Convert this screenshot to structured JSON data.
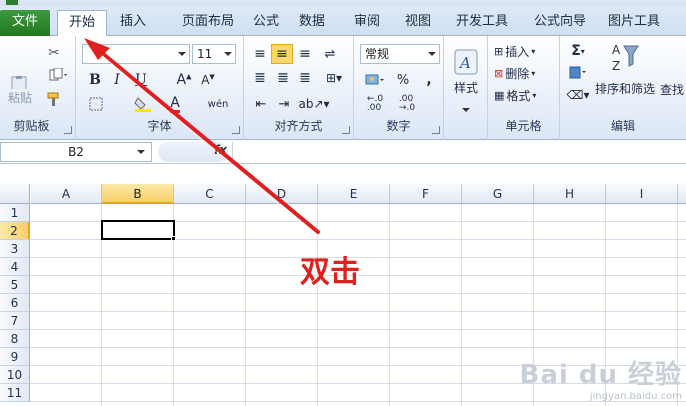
{
  "ribbon_tabs": [
    "文件",
    "开始",
    "插入",
    "页面布局",
    "公式",
    "数据",
    "审阅",
    "视图",
    "开发工具",
    "公式向导",
    "图片工具"
  ],
  "active_tab": "开始",
  "groups": {
    "clipboard": {
      "label": "剪贴板",
      "paste_label": "粘贴"
    },
    "font": {
      "label": "字体",
      "font_name": "",
      "font_size": "11",
      "bold": "B",
      "italic": "I",
      "underline": "U"
    },
    "alignment": {
      "label": "对齐方式"
    },
    "number": {
      "label": "数字",
      "format": "常规",
      "percent": "%",
      "comma": ","
    },
    "styles": {
      "label": "样式"
    },
    "cells": {
      "label": "单元格",
      "insert": "插入",
      "delete": "删除",
      "format": "格式"
    },
    "editing": {
      "label": "编辑",
      "sort_filter": "排序和筛选",
      "find": "查找"
    }
  },
  "name_box": "B2",
  "fx_label": "fx",
  "columns": [
    "A",
    "B",
    "C",
    "D",
    "E",
    "F",
    "G",
    "H",
    "I"
  ],
  "rows": [
    "1",
    "2",
    "3",
    "4",
    "5",
    "6",
    "7",
    "8",
    "9",
    "10",
    "11"
  ],
  "selected_cell": "B2",
  "annotation": "双击",
  "watermark": {
    "brand": "Bai du 经验",
    "url": "jingyan.baidu.com"
  },
  "colors": {
    "file_tab": "#2e8b2e",
    "selection": "#f8cf68",
    "annotation": "#e0201f"
  },
  "icons": [
    "cut-icon",
    "copy-icon",
    "format-painter-icon",
    "sigma-icon",
    "sort-filter-icon"
  ]
}
